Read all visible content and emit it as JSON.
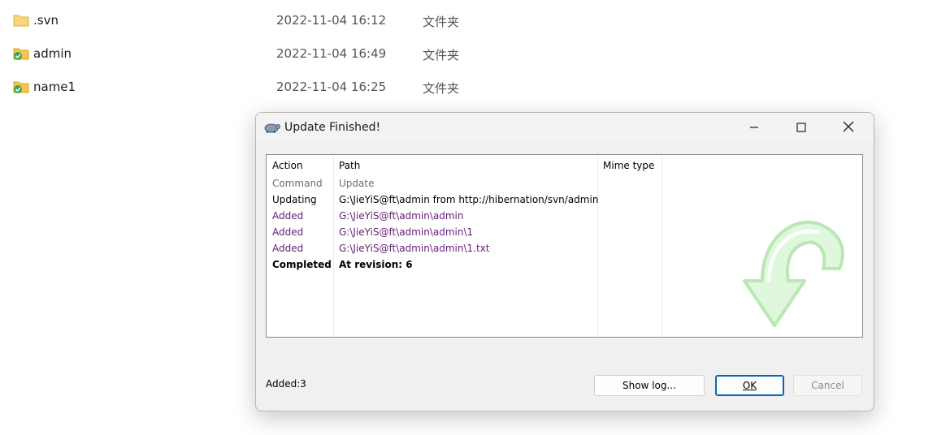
{
  "files": [
    {
      "name": ".svn",
      "date": "2022-11-04 16:12",
      "type": "文件夹",
      "icon": "folder-icon"
    },
    {
      "name": "admin",
      "date": "2022-11-04 16:49",
      "type": "文件夹",
      "icon": "svn-folder-ok-icon"
    },
    {
      "name": "name1",
      "date": "2022-11-04 16:25",
      "type": "文件夹",
      "icon": "svn-folder-ok-icon"
    }
  ],
  "dialog": {
    "title": "Update Finished!",
    "columns": [
      "Action",
      "Path",
      "Mime type"
    ],
    "rows": [
      {
        "action": "Command",
        "path": "Update"
      },
      {
        "action": "Updating",
        "path": "G:\\JieYiS@ft\\admin from http://hibernation/svn/admin"
      },
      {
        "action": "Added",
        "path": "G:\\JieYiS@ft\\admin\\admin"
      },
      {
        "action": "Added",
        "path": "G:\\JieYiS@ft\\admin\\admin\\1"
      },
      {
        "action": "Added",
        "path": "G:\\JieYiS@ft\\admin\\admin\\1.txt"
      },
      {
        "action": "Completed",
        "path": "At revision: 6"
      }
    ],
    "status": "Added:3",
    "buttons": {
      "show_log": "Show log...",
      "ok": "OK",
      "cancel": "Cancel"
    }
  },
  "colors": {
    "added": "#6a1b7a",
    "accent": "#0067c0",
    "folder": "#f4c64a",
    "svn_ok": "#3aa54a"
  }
}
